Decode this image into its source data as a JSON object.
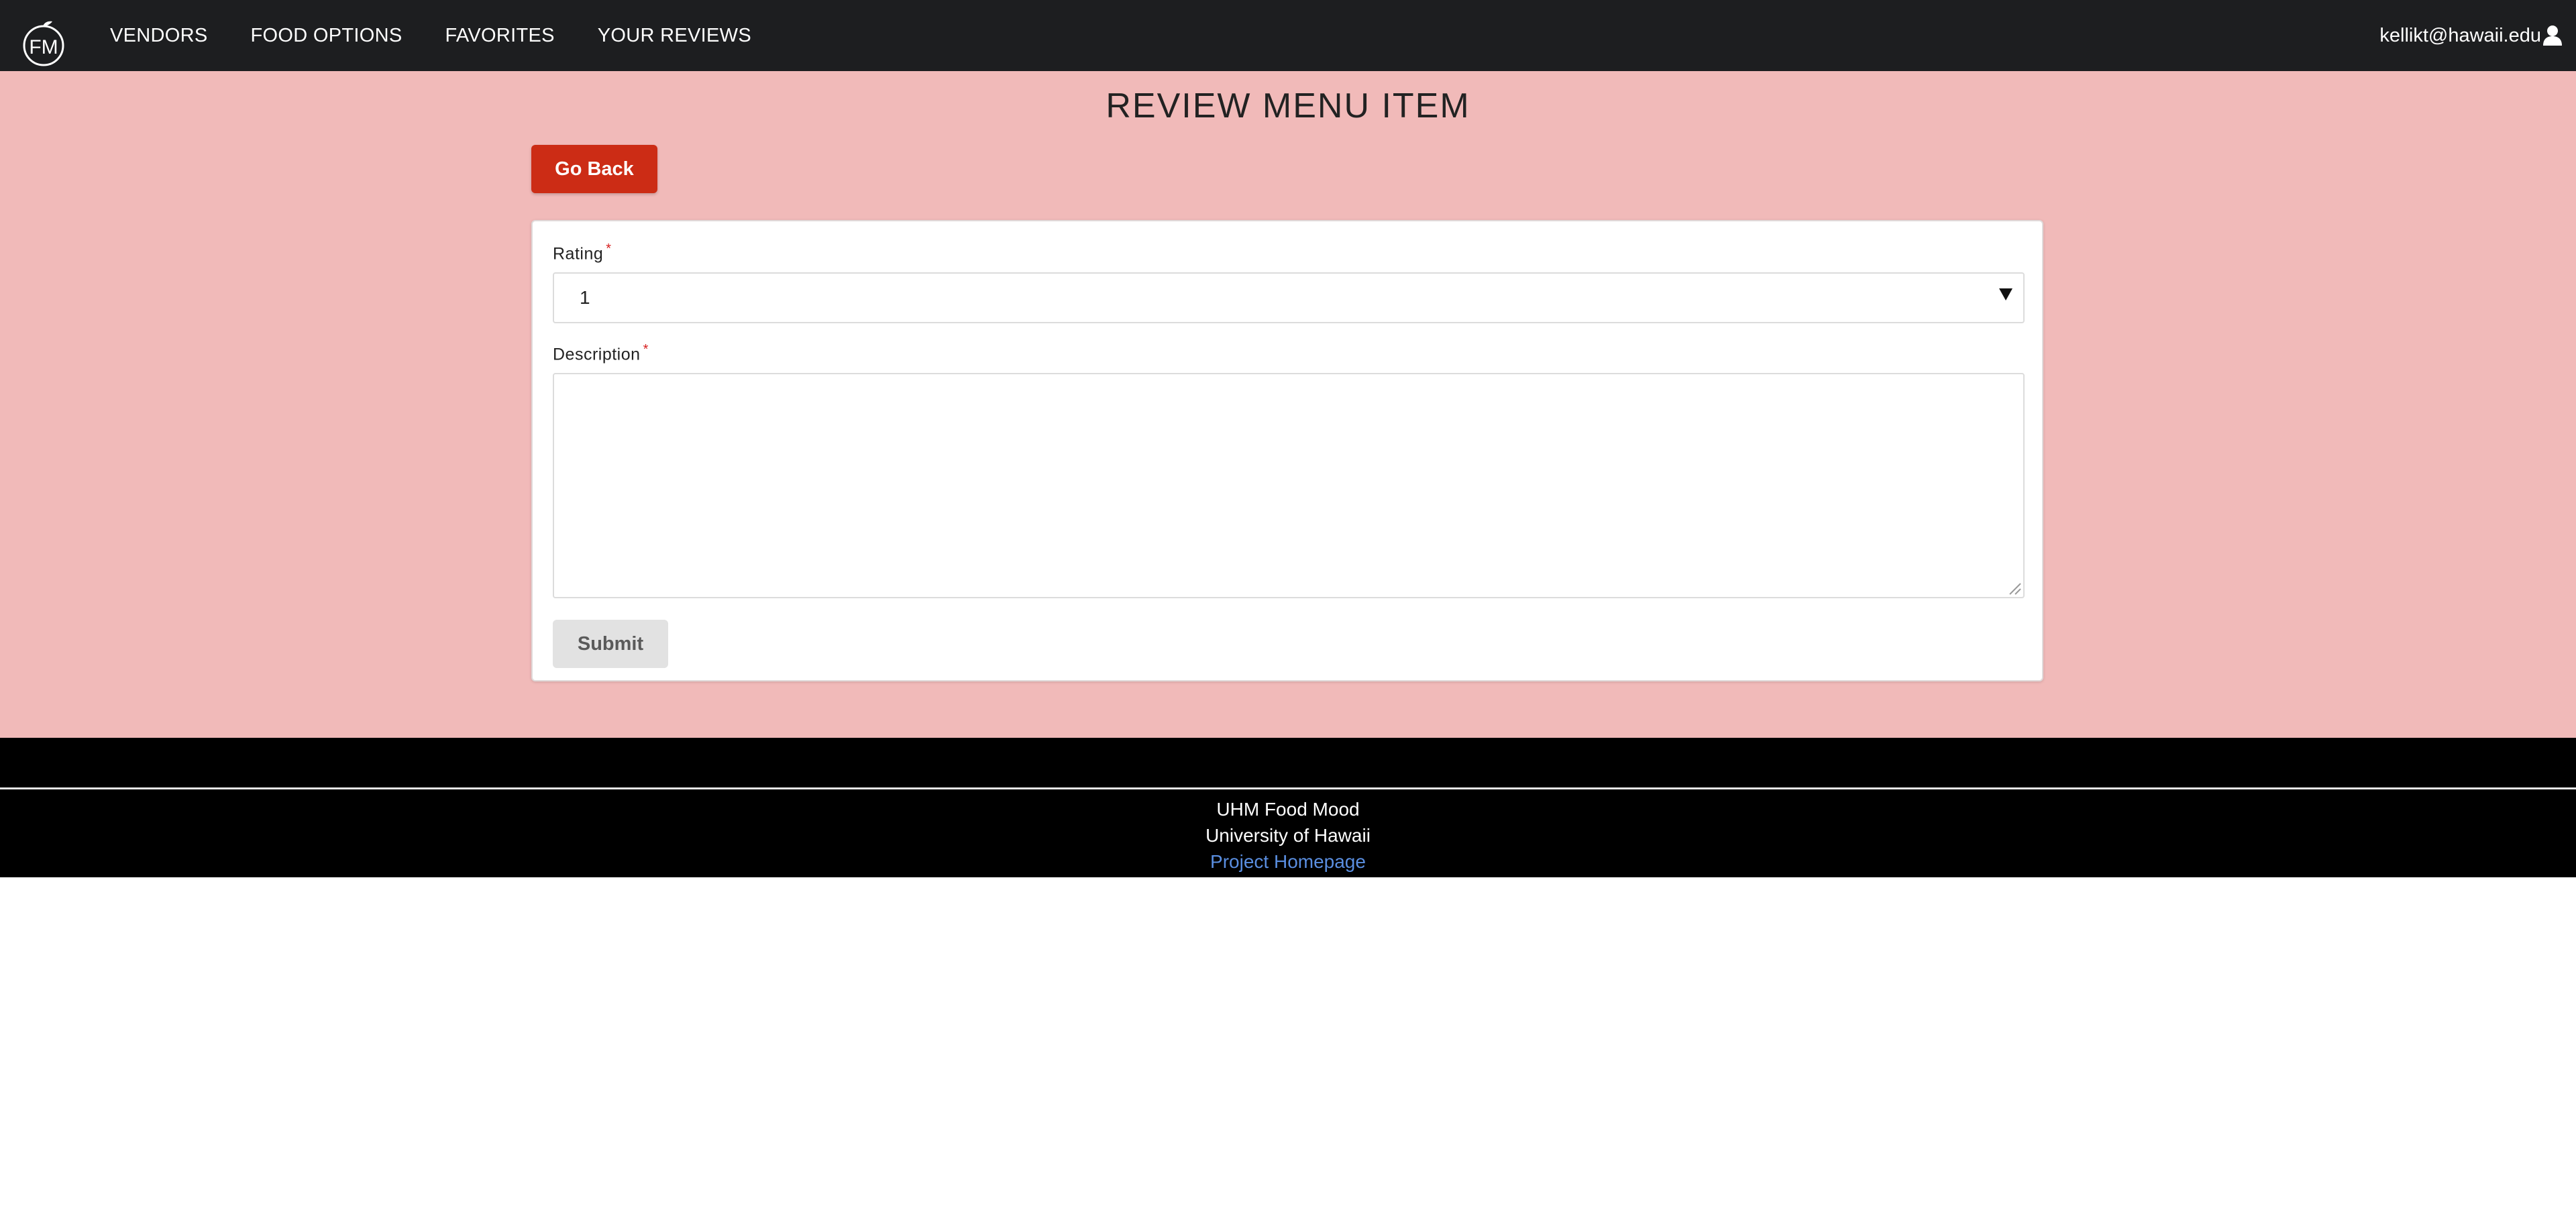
{
  "navbar": {
    "logo_text": "FM",
    "links": [
      "VENDORS",
      "FOOD OPTIONS",
      "FAVORITES",
      "YOUR REVIEWS"
    ],
    "user_email": "kellikt@hawaii.edu",
    "user_icon": "user-icon"
  },
  "page": {
    "title": "REVIEW MENU ITEM",
    "go_back_label": "Go Back"
  },
  "form": {
    "rating_label": "Rating",
    "rating_value": "1",
    "description_label": "Description",
    "description_value": "",
    "required_marker": "*",
    "submit_label": "Submit"
  },
  "footer": {
    "line1": "UHM Food Mood",
    "line2": "University of Hawaii",
    "link_text": "Project Homepage"
  },
  "colors": {
    "navbar_bg": "#1d1e20",
    "page_bg": "#f1bab9",
    "go_back_bg": "#cc2c15",
    "link_blue": "#5a8ee0"
  }
}
